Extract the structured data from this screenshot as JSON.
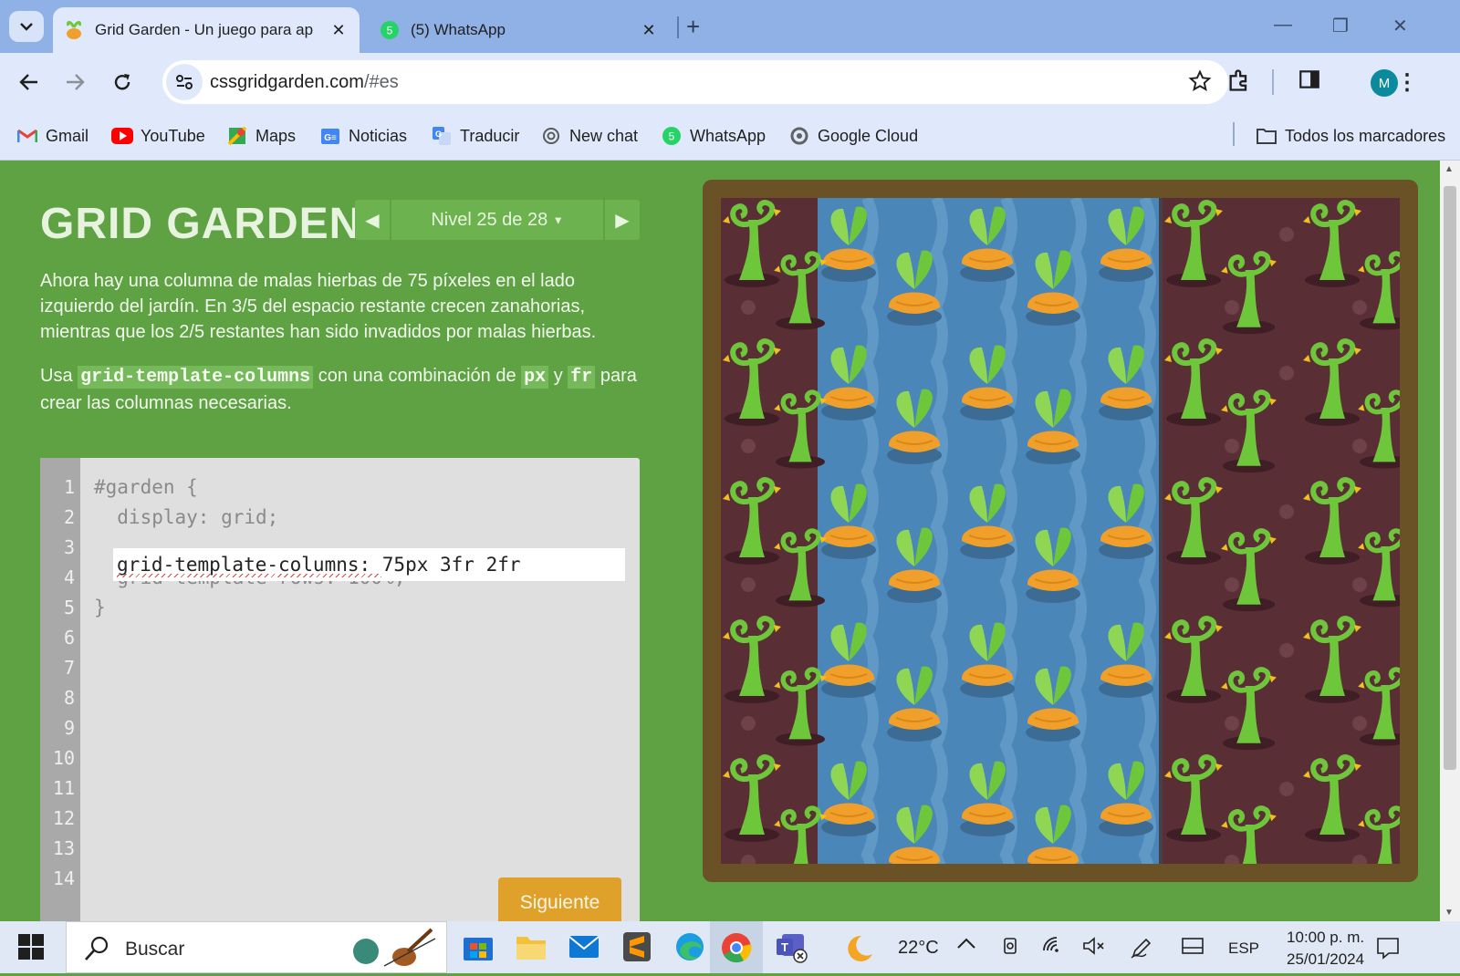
{
  "browser": {
    "tabs": [
      {
        "title": "Grid Garden - Un juego para ap",
        "active": true
      },
      {
        "title": "(5) WhatsApp",
        "active": false,
        "badge": "5"
      }
    ],
    "omnibox": {
      "domain": "cssgridgarden.com",
      "path": "/#es"
    },
    "profile_initial": "M",
    "bookmarks": [
      {
        "label": "Gmail",
        "icon": "gmail-icon"
      },
      {
        "label": "YouTube",
        "icon": "youtube-icon"
      },
      {
        "label": "Maps",
        "icon": "maps-icon"
      },
      {
        "label": "Noticias",
        "icon": "news-icon"
      },
      {
        "label": "Traducir",
        "icon": "translate-icon"
      },
      {
        "label": "New chat",
        "icon": "chatgpt-icon"
      },
      {
        "label": "WhatsApp",
        "icon": "whatsapp-icon"
      },
      {
        "label": "Google Cloud",
        "icon": "google-cloud-icon"
      }
    ],
    "all_bookmarks": "Todos los marcadores"
  },
  "page": {
    "logo": "GRID GARDEN",
    "level_label": "Nivel 25 de 28",
    "instructions": {
      "p1": "Ahora hay una columna de malas hierbas de 75 píxeles en el lado izquierdo del jardín. En 3/5 del espacio restante crecen zanahorias, mientras que los 2/5 restantes han sido invadidos por malas hierbas.",
      "p2_before": "Usa",
      "p2_code1": "grid-template-columns",
      "p2_mid": "con una combinación de",
      "p2_code2": "px",
      "p2_and": "y",
      "p2_code3": "fr",
      "p2_after": "para crear las columnas necesarias."
    },
    "editor": {
      "line_numbers": [
        "1",
        "2",
        "3",
        "4",
        "5",
        "6",
        "7",
        "8",
        "9",
        "10",
        "11",
        "12",
        "13",
        "14"
      ],
      "line1": "#garden {",
      "line2": "  display: grid;",
      "input_value": "grid-template-columns: 75px 3fr 2fr",
      "line4": "  grid-template-rows: 100%;",
      "line5": "}"
    },
    "next_button": "Siguiente",
    "garden": {
      "rows": 5,
      "columns": [
        "weeds",
        "water",
        "water",
        "water",
        "water",
        "water",
        "weeds"
      ]
    }
  },
  "taskbar": {
    "search_placeholder": "Buscar",
    "weather": "22°C",
    "language": "ESP",
    "time": "10:00 p. m.",
    "date": "25/01/2024"
  },
  "colors": {
    "page_bg": "#5ea243",
    "soil": "#5a2e35",
    "water": "#4a86b8",
    "carrot": "#f0a02a",
    "weed": "#6ec63b",
    "frame": "#6b5226"
  }
}
